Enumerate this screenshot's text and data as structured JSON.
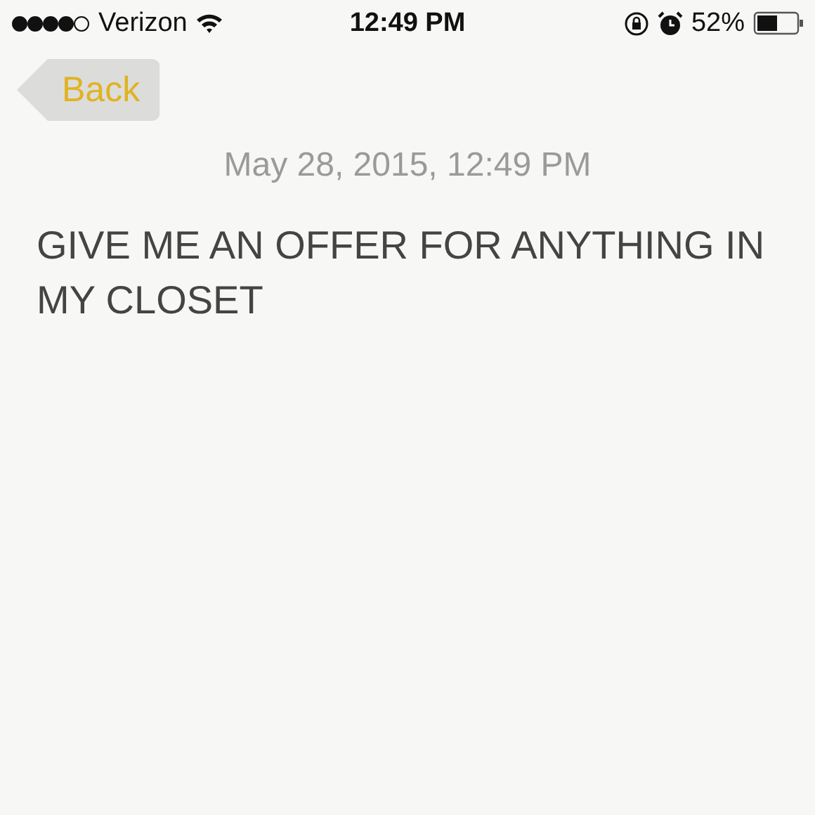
{
  "status_bar": {
    "carrier": "Verizon",
    "time": "12:49 PM",
    "battery": "52%"
  },
  "back_button": {
    "label": "Back"
  },
  "note": {
    "date": "May 28, 2015, 12:49 PM",
    "body": "GIVE ME AN OFFER FOR ANYTHING IN MY CLOSET"
  }
}
